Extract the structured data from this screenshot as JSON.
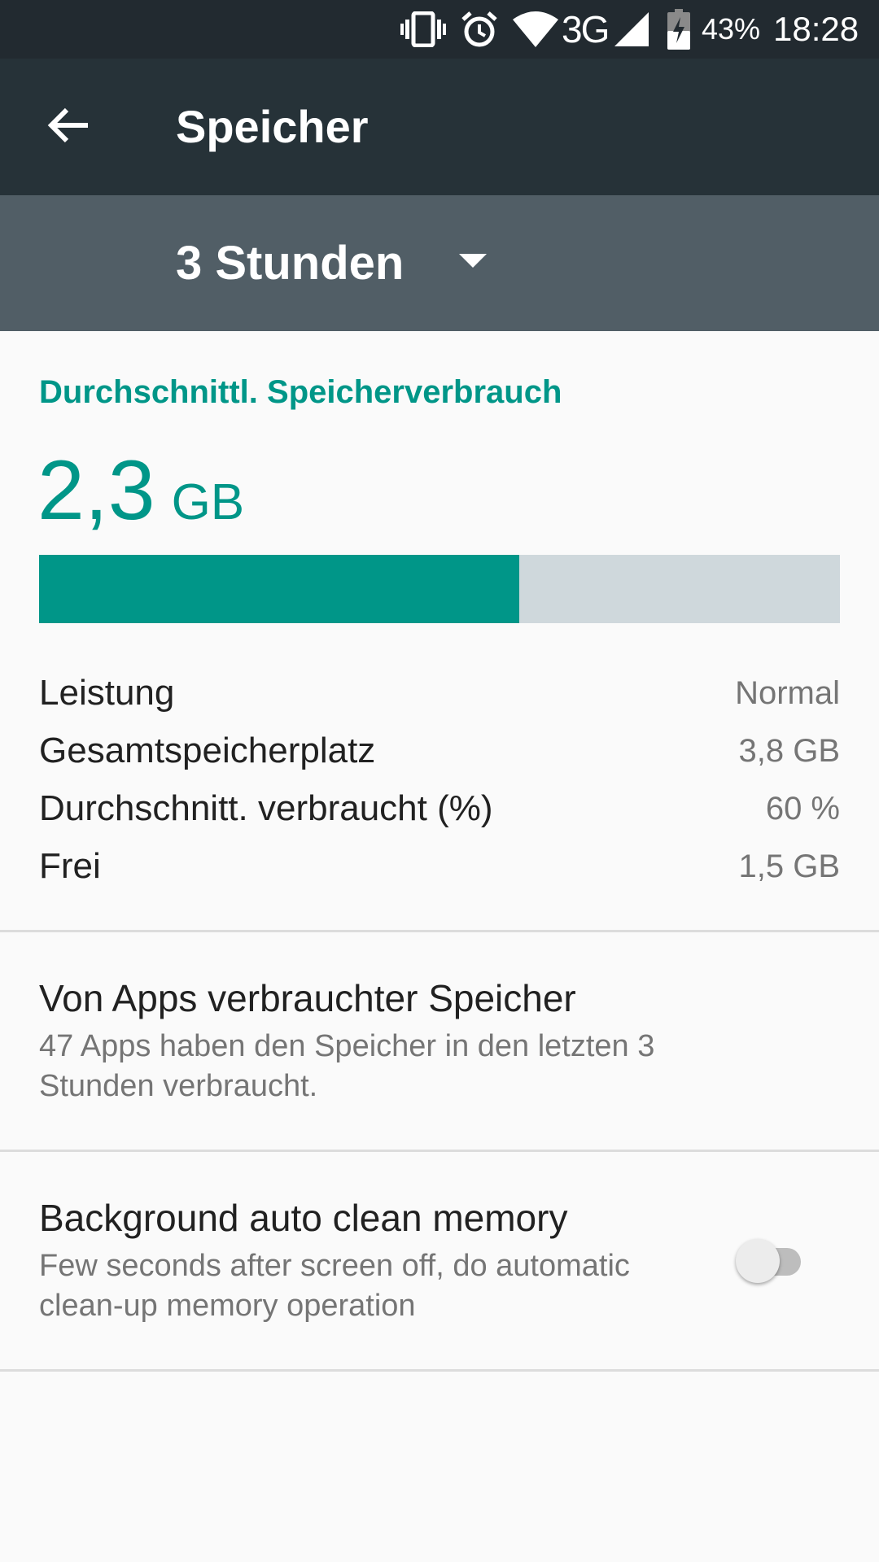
{
  "status_bar": {
    "battery": "43%",
    "time": "18:28",
    "network": "3G",
    "icons": [
      "vibrate-icon",
      "alarm-icon",
      "wifi-icon",
      "signal-icon",
      "battery-charging-icon"
    ]
  },
  "app_bar": {
    "back_icon": "arrow-back-icon",
    "title": "Speicher"
  },
  "period_selector": {
    "selected": "3 Stunden",
    "icon": "dropdown-arrow-icon"
  },
  "summary": {
    "heading": "Durchschnittl. Speicherverbrauch",
    "value": "2,3",
    "unit": "GB",
    "usage_fraction": 0.6
  },
  "stats": [
    {
      "label": "Leistung",
      "value": "Normal"
    },
    {
      "label": "Gesamtspeicherplatz",
      "value": "3,8 GB"
    },
    {
      "label": "Durchschnitt. verbraucht (%)",
      "value": "60 %"
    },
    {
      "label": "Frei",
      "value": "1,5 GB"
    }
  ],
  "apps_item": {
    "title": "Von Apps verbrauchter Speicher",
    "subtitle": "47 Apps haben den Speicher in den letzten 3 Stunden verbraucht."
  },
  "auto_clean_item": {
    "title": "Background auto clean memory",
    "subtitle": "Few seconds after screen off, do automatic clean-up memory operation",
    "enabled": false
  },
  "colors": {
    "accent": "#009688",
    "app_bar": "#263238",
    "period_bar": "#515e66",
    "track": "#cfd8dc"
  }
}
